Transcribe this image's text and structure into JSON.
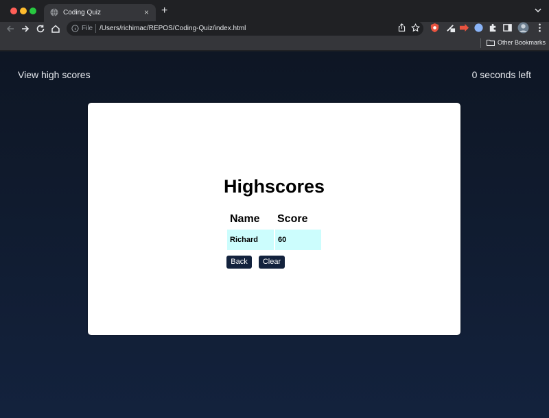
{
  "browser": {
    "tab_title": "Coding Quiz",
    "tab_close": "×",
    "new_tab": "+",
    "omnibox_scheme": "File",
    "omnibox_url": "/Users/richimac/REPOS/Coding-Quiz/index.html",
    "bookmark_folder": "Other Bookmarks",
    "icons": [
      "back-icon",
      "forward-icon",
      "reload-icon",
      "home-icon",
      "info-icon",
      "share-icon",
      "star-icon",
      "extension-icon",
      "sidebar-icon",
      "profile-icon",
      "menu-icon",
      "folder-icon"
    ]
  },
  "header": {
    "view_high_scores": "View high scores",
    "timer": "0 seconds left"
  },
  "highscores": {
    "title": "Highscores",
    "columns": [
      "Name",
      "Score"
    ],
    "rows": [
      {
        "name": "Richard",
        "score": "60"
      }
    ],
    "back_label": "Back",
    "clear_label": "Clear"
  },
  "colors": {
    "page_bg_top": "#0e1624",
    "page_bg_bottom": "#13223d",
    "row_bg": "#ccfdfd",
    "button_bg": "#13223d"
  }
}
